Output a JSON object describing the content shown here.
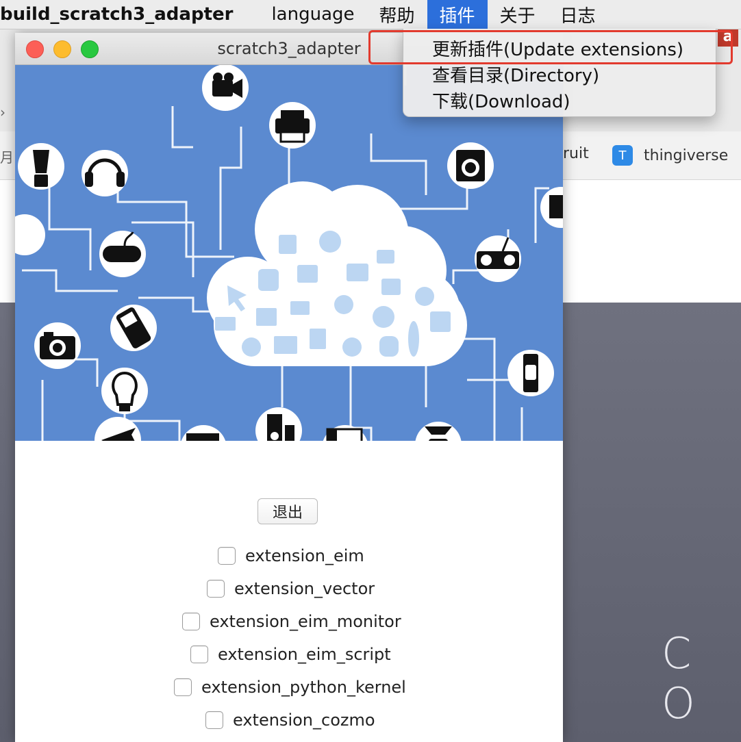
{
  "menubar": {
    "app_name": "build_scratch3_adapter",
    "menus": [
      "language",
      "帮助",
      "插件",
      "关于",
      "日志"
    ],
    "active_menu": "插件"
  },
  "plugin_menu": {
    "items": [
      "更新插件(Update extensions)",
      "查看目录(Directory)",
      "下载(Download)"
    ],
    "highlighted_item": "更新插件(Update extensions)"
  },
  "background_browser": {
    "bookmarks": [
      "ruit",
      "thingiverse"
    ],
    "left_partial_glyph": "月",
    "left_partial_arrow": "›",
    "red_tile_letter": "a",
    "page_text": "C O"
  },
  "window": {
    "title": "scratch3_adapter",
    "quit_label": "退出",
    "extensions": [
      "extension_eim",
      "extension_vector",
      "extension_eim_monitor",
      "extension_eim_script",
      "extension_python_kernel",
      "extension_cozmo"
    ]
  },
  "colors": {
    "menu_accent": "#2c6fdb",
    "highlight_red": "#e23a2e",
    "hero_blue": "#5b8ad0",
    "close": "#fc5f57",
    "minimize": "#fdbc2e",
    "zoom": "#28c840"
  },
  "icons": {
    "hero": [
      "video-camera-icon",
      "printer-icon",
      "blender-icon",
      "headphones-icon",
      "gamepad-icon",
      "washing-machine-icon",
      "boombox-icon",
      "mobile-phone-icon",
      "camera-icon",
      "light-bulb-icon",
      "speaker-icon",
      "scale-icon",
      "watch-icon",
      "airplane-icon",
      "monitor-icon",
      "cloud-icon"
    ]
  }
}
